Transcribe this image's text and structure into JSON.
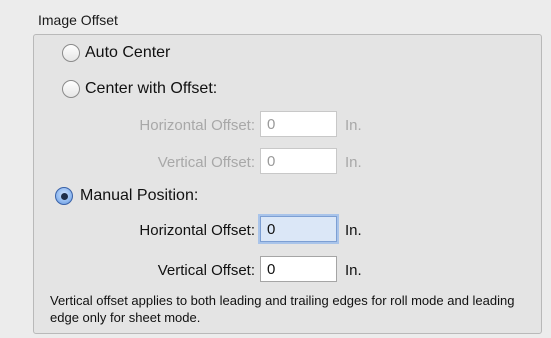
{
  "group": {
    "title": "Image Offset"
  },
  "options": {
    "auto_center": {
      "label": "Auto Center",
      "selected": false
    },
    "center_offset": {
      "label": "Center with Offset:",
      "selected": false,
      "horizontal_label": "Horizontal Offset:",
      "horizontal_value": "0",
      "vertical_label": "Vertical Offset:",
      "vertical_value": "0",
      "unit": "In."
    },
    "manual": {
      "label": "Manual Position:",
      "selected": true,
      "horizontal_label": "Horizontal Offset:",
      "horizontal_value": "0",
      "vertical_label": "Vertical Offset:",
      "vertical_value": "0",
      "unit": "In."
    }
  },
  "note": "Vertical offset applies to both leading and trailing edges for roll mode and leading edge only for sheet mode."
}
